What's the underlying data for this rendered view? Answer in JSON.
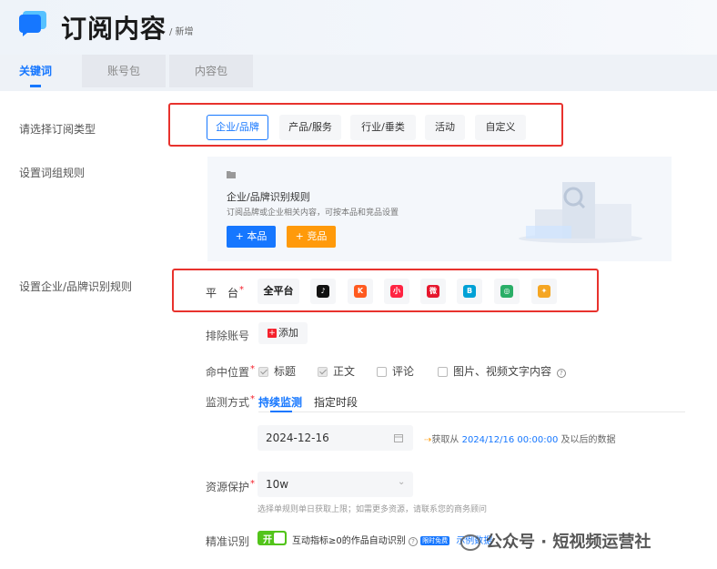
{
  "header": {
    "title": "订阅内容",
    "crumb": "/ 新增"
  },
  "tabs": [
    "关键词",
    "账号包",
    "内容包"
  ],
  "labels": {
    "sub_type": "请选择订阅类型",
    "word_rule": "设置词组规则",
    "brand_rule": "设置企业/品牌识别规则",
    "platform": "平　台",
    "exclude": "排除账号",
    "hit_pos": "命中位置",
    "monitor": "监测方式",
    "resource": "资源保护",
    "precise": "精准识别"
  },
  "sub_types": [
    "企业/品牌",
    "产品/服务",
    "行业/垂类",
    "活动",
    "自定义"
  ],
  "panel": {
    "heading": "企业/品牌识别规则",
    "desc": "订阅品牌或企业相关内容，可按本品和竞品设置",
    "btn_own": "+ 本品",
    "btn_comp": "+ 竞品"
  },
  "platforms": {
    "all": "全平台",
    "items": [
      {
        "name": "douyin-icon",
        "glyph": "♪",
        "color": "#111111"
      },
      {
        "name": "kuaishou-icon",
        "glyph": "K",
        "color": "#ff5a1f"
      },
      {
        "name": "xiaohongshu-icon",
        "glyph": "小",
        "color": "#ff2442"
      },
      {
        "name": "weibo-icon",
        "glyph": "微",
        "color": "#e6162d"
      },
      {
        "name": "bilibili-icon",
        "glyph": "B",
        "color": "#00a1d6"
      },
      {
        "name": "wechat-icon",
        "glyph": "◎",
        "color": "#2aae67"
      },
      {
        "name": "other-platform-icon",
        "glyph": "✦",
        "color": "#f5a623"
      }
    ]
  },
  "exclude_add": "添加",
  "positions": [
    {
      "label": "标题",
      "checked": true
    },
    {
      "label": "正文",
      "checked": true
    },
    {
      "label": "评论",
      "checked": false
    },
    {
      "label": "图片、视频文字内容",
      "checked": false
    }
  ],
  "monitor_tabs": [
    "持续监测",
    "指定时段"
  ],
  "date": "2024-12-16",
  "fetch": {
    "prefix": "获取从",
    "ts": "2024/12/16 00:00:00",
    "suffix": "及以后的数据"
  },
  "resource": {
    "value": "10w",
    "hint": "选择单规则单日获取上限；如需更多资源，请联系您的商务顾问"
  },
  "precise": {
    "toggle": "开",
    "text": "互动指标≥0的作品自动识别",
    "badge": "限时免费",
    "example": "示例数据"
  },
  "watermark": "公众号 · 短视频运营社",
  "colors": {
    "accent": "#1677ff",
    "red_box": "#e8322d",
    "orange": "#ff9a0a",
    "green": "#52c41a"
  }
}
